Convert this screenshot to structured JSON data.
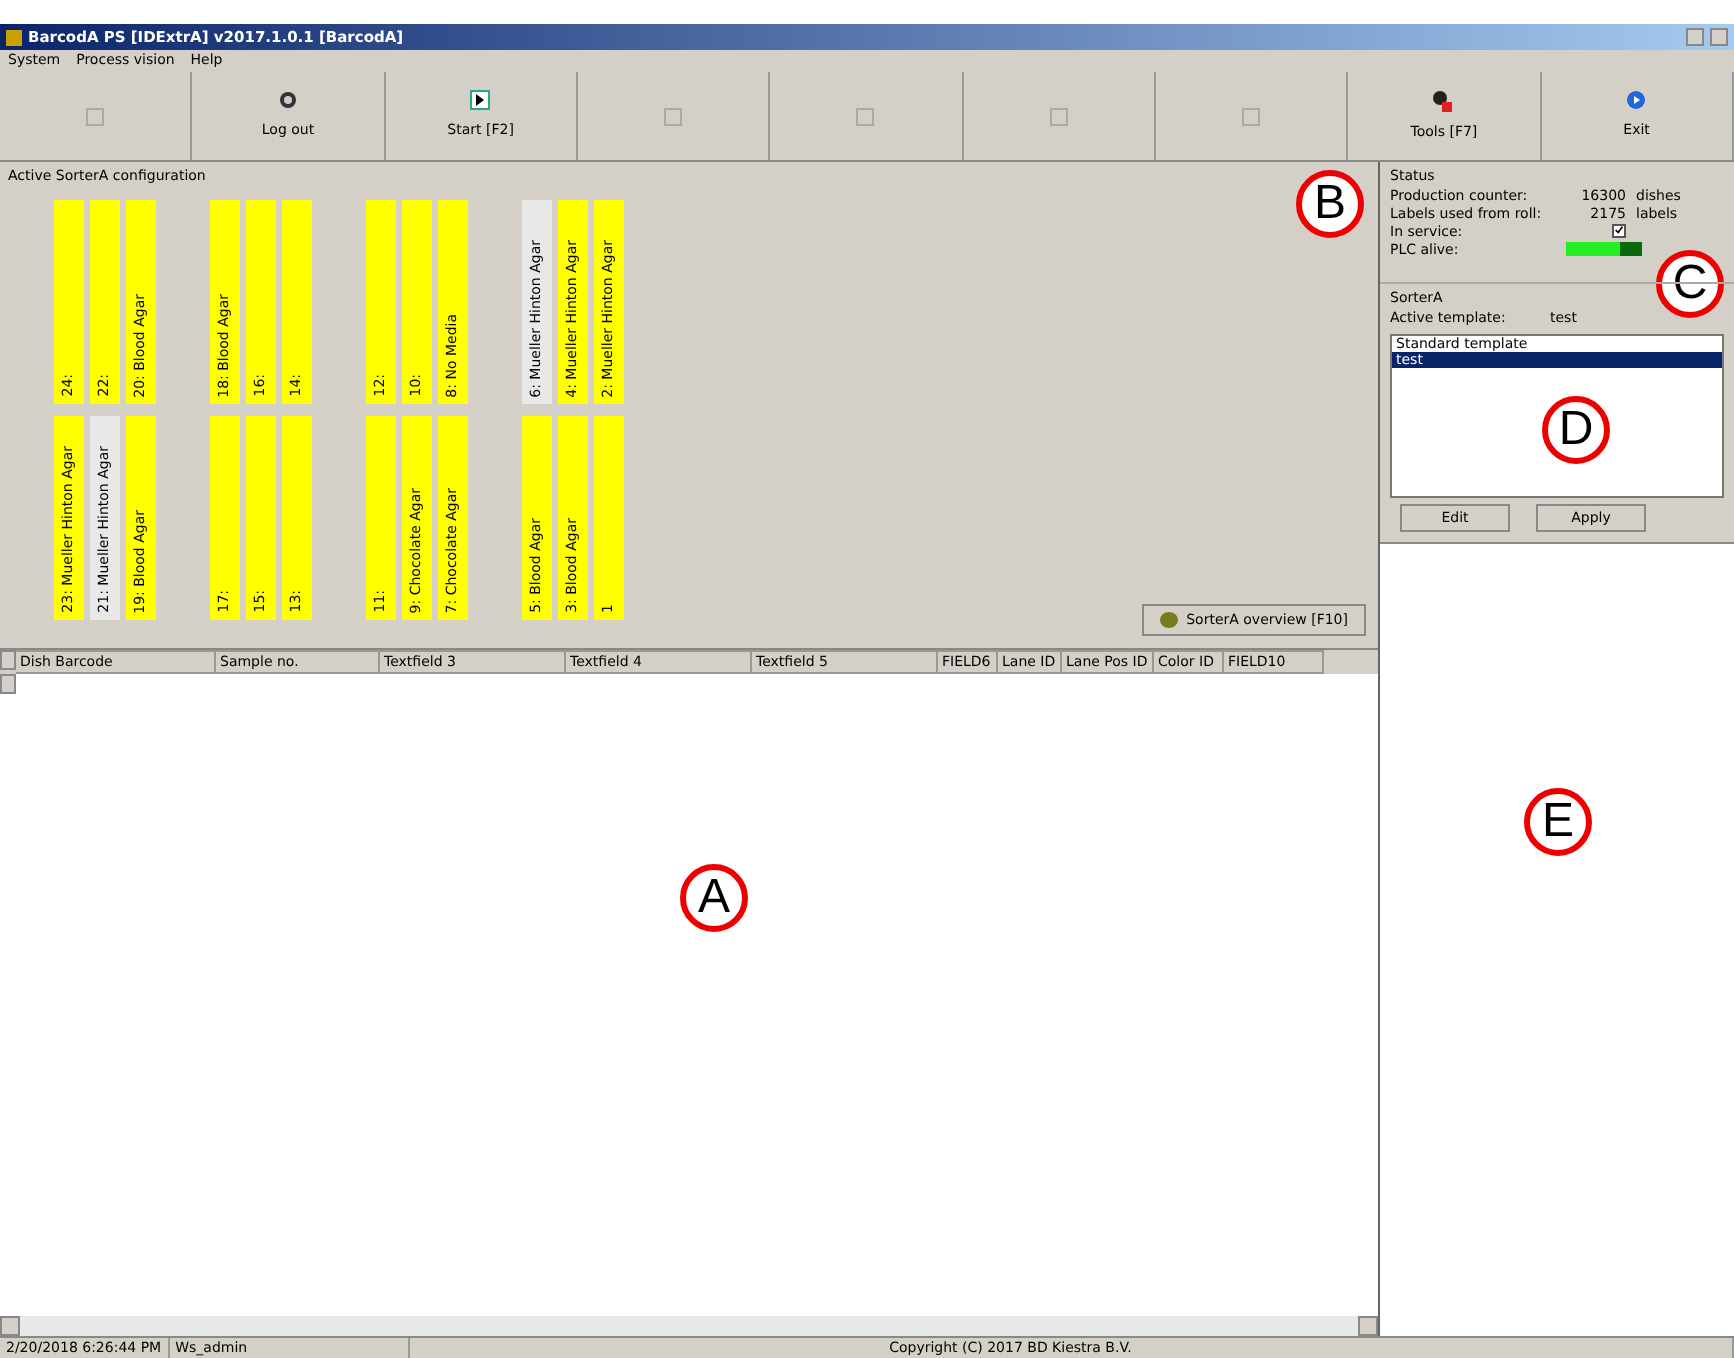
{
  "window": {
    "title": "BarcodA PS [IDExtrA] v2017.1.0.1 [BarcodA]"
  },
  "menu": [
    "System",
    "Process vision",
    "Help"
  ],
  "toolbar": [
    {
      "kind": "blank",
      "disabled": true
    },
    {
      "kind": "logout",
      "label": "Log out",
      "disabled": false
    },
    {
      "kind": "start",
      "label": "Start [F2]",
      "disabled": false
    },
    {
      "kind": "blank",
      "disabled": true
    },
    {
      "kind": "blank",
      "disabled": true
    },
    {
      "kind": "blank",
      "disabled": true
    },
    {
      "kind": "blank",
      "disabled": true
    },
    {
      "kind": "tools",
      "label": "Tools [F7]",
      "disabled": false
    },
    {
      "kind": "exit",
      "label": "Exit",
      "disabled": false
    }
  ],
  "sorter_config": {
    "title": "Active SorterA configuration",
    "callout": "B",
    "overview_button": "SorterA overview [F10]",
    "rows": [
      [
        [
          {
            "label": "24:",
            "color": "#ffff00"
          },
          {
            "label": "22:",
            "color": "#ffff00"
          },
          {
            "label": "20: Blood Agar",
            "color": "#ffff00"
          }
        ],
        [
          {
            "label": "18: Blood Agar",
            "color": "#ffff00"
          },
          {
            "label": "16:",
            "color": "#ffff00"
          },
          {
            "label": "14:",
            "color": "#ffff00"
          }
        ],
        [
          {
            "label": "12:",
            "color": "#ffff00"
          },
          {
            "label": "10:",
            "color": "#ffff00"
          },
          {
            "label": "8: No Media",
            "color": "#ffff00"
          }
        ],
        [
          {
            "label": "6: Mueller Hinton Agar",
            "color": "#e8e8e8"
          },
          {
            "label": "4: Mueller Hinton Agar",
            "color": "#ffff00"
          },
          {
            "label": "2: Mueller Hinton Agar",
            "color": "#ffff00"
          }
        ]
      ],
      [
        [
          {
            "label": "23: Mueller Hinton Agar",
            "color": "#ffff00"
          },
          {
            "label": "21: Mueller Hinton Agar",
            "color": "#e8e8e8"
          },
          {
            "label": "19: Blood Agar",
            "color": "#ffff00"
          }
        ],
        [
          {
            "label": "17:",
            "color": "#ffff00"
          },
          {
            "label": "15:",
            "color": "#ffff00"
          },
          {
            "label": "13:",
            "color": "#ffff00"
          }
        ],
        [
          {
            "label": "11:",
            "color": "#ffff00"
          },
          {
            "label": "9: Chocolate Agar",
            "color": "#ffff00"
          },
          {
            "label": "7: Chocolate Agar",
            "color": "#ffff00"
          }
        ],
        [
          {
            "label": "5: Blood Agar",
            "color": "#ffff00"
          },
          {
            "label": "3: Blood Agar",
            "color": "#ffff00"
          },
          {
            "label": "1",
            "color": "#ffff00"
          }
        ]
      ]
    ]
  },
  "table": {
    "columns": [
      "Dish Barcode",
      "Sample no.",
      "Textfield 3",
      "Textfield 4",
      "Textfield 5",
      "FIELD6",
      "Lane ID",
      "Lane Pos ID",
      "Color ID",
      "FIELD10"
    ],
    "callout": "A"
  },
  "status": {
    "title": "Status",
    "callout": "C",
    "rows": [
      {
        "kind": "value",
        "label": "Production counter:",
        "value": "16300",
        "unit": "dishes"
      },
      {
        "kind": "value",
        "label": "Labels used from roll:",
        "value": "2175",
        "unit": "labels"
      },
      {
        "kind": "check",
        "label": "In service:",
        "checked": true
      },
      {
        "kind": "meter",
        "label": "PLC alive:",
        "level": 0.7
      }
    ]
  },
  "sorter": {
    "title": "SorterA",
    "active_label": "Active template:",
    "active_value": "test",
    "callout": "D",
    "templates": [
      {
        "name": "Standard template",
        "selected": false
      },
      {
        "name": "test",
        "selected": true
      }
    ],
    "buttons": [
      "Edit",
      "Apply"
    ]
  },
  "side_panel": {
    "callout": "E"
  },
  "status_bar": [
    "2/20/2018 6:26:44 PM",
    "Ws_admin",
    "Copyright (C) 2017 BD Kiestra B.V."
  ]
}
